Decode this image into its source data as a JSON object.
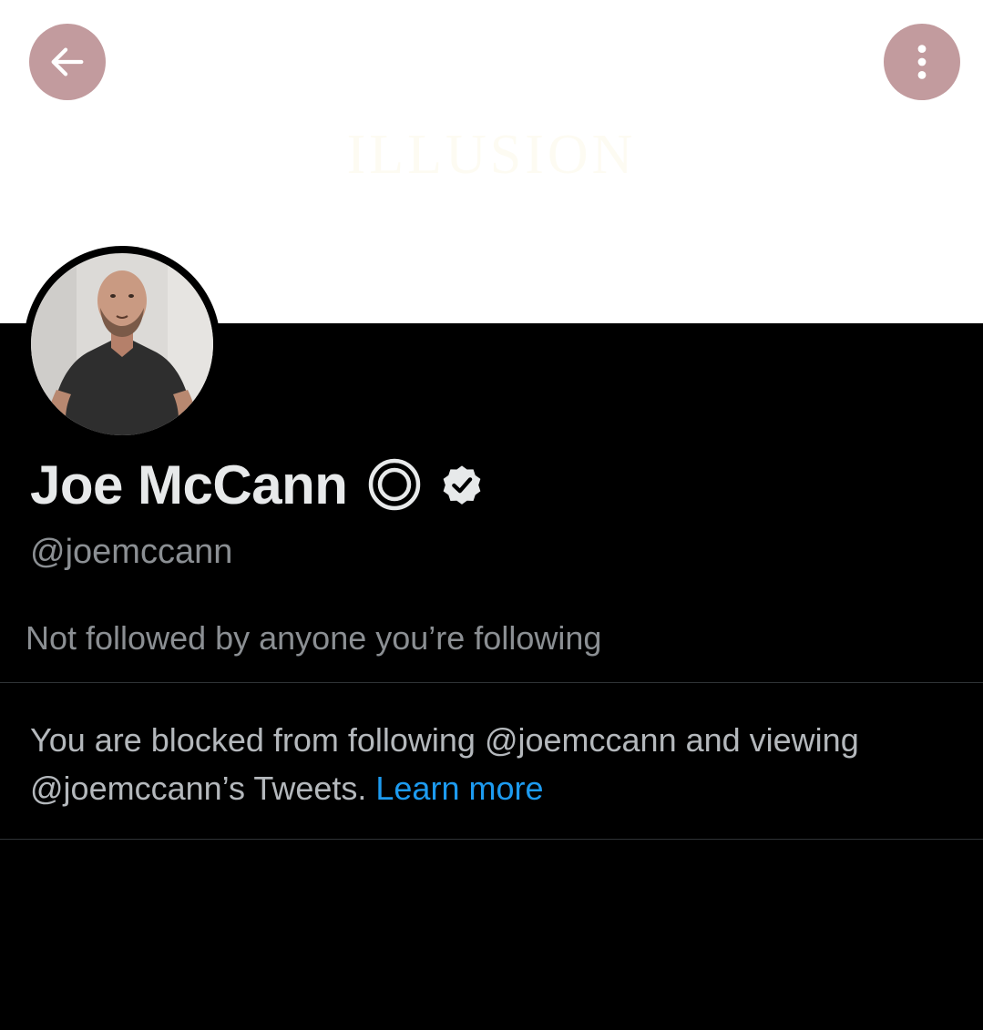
{
  "colors": {
    "background": "#000000",
    "banner_background": "#ffffff",
    "banner_text": "#fdfbf2",
    "nav_button_background": "#c29b9e",
    "name_text": "#e7e9ea",
    "secondary_text": "#8b8f93",
    "notice_text": "#b4b8bc",
    "link": "#1d9bf0",
    "divider": "#2f3336"
  },
  "header": {
    "banner_text": "ILLUSION",
    "back_button_icon": "arrow-left-icon",
    "more_button_icon": "more-vertical-icon"
  },
  "profile": {
    "avatar_icon": "profile-photo",
    "display_name": "Joe McCann",
    "badges": [
      "ring-icon",
      "verified-badge-icon"
    ],
    "handle": "@joemccann",
    "follow_context": "Not followed by anyone you’re following"
  },
  "blocked": {
    "message": "You are blocked from following @joemccann and viewing @joemccann’s Tweets. ",
    "learn_more_label": "Learn more"
  }
}
